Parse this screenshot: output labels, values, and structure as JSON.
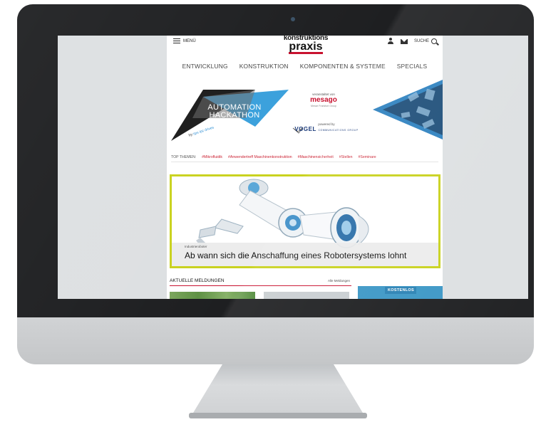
{
  "site": {
    "menu_label": "MENÜ",
    "logo_top": "konstruktions",
    "logo_bottom": "praxis",
    "search_label": "SUCHE"
  },
  "nav": {
    "items": [
      "ENTWICKLUNG",
      "KONSTRUKTION",
      "KOMPONENTEN & SYSTEME",
      "SPECIALS"
    ]
  },
  "banner": {
    "event_line1": "AUTOMATION",
    "event_line2": "HACKATHON",
    "by_prefix": "by",
    "by_brand": "sps ipc drives",
    "organizer_label": "veranstaltet von",
    "organizer": "mesago",
    "organizer_tagline": "Messe Frankfurt Group",
    "powered_label": "powered by",
    "sponsor": "VOGEL",
    "sponsor_suffix": "COMMUNICATIONS GROUP"
  },
  "topics": {
    "label": "TOP THEMEN:",
    "items": [
      "#Mikrofluidik",
      "#Anwendertreff Maschinenkonstruktion",
      "#Maschinensicherheit",
      "#Stellen",
      "#Seminare"
    ]
  },
  "feature": {
    "kicker": "Industrieroboter",
    "title": "Ab wann sich die Anschaffung eines Robotersystems lohnt"
  },
  "news": {
    "title": "AKTUELLE MELDUNGEN",
    "all_link": "Alle Meldungen"
  },
  "ad": {
    "label": "KOSTENLOS"
  },
  "colors": {
    "accent_red": "#c8102e",
    "feature_border": "#c9d21e",
    "hackathon_blue": "#3aa0dc",
    "ad_blue": "#3c97c6"
  }
}
